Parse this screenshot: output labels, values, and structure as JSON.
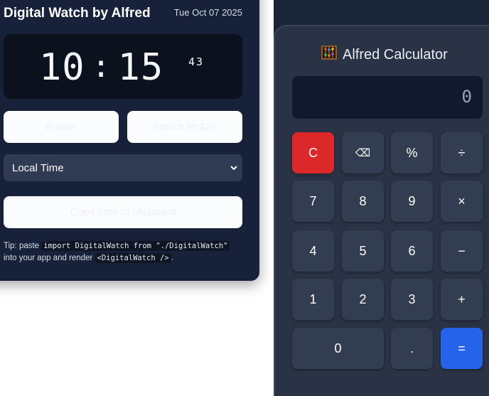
{
  "watch": {
    "title": "Digital Watch by Alfred",
    "date": "Tue Oct 07 2025",
    "time": {
      "hours": "10",
      "separator": ":",
      "minutes": "15",
      "seconds": "43"
    },
    "pause_label": "Pause",
    "switch_label": "Switch to 12h",
    "timezone_selected": "Local Time",
    "copy_label": "Copy time to clipboard",
    "tip": {
      "prefix": "Tip: paste",
      "code1": "import DigitalWatch from \"./DigitalWatch\"",
      "middle": "into your app and render",
      "code2": "<DigitalWatch />",
      "suffix": "."
    }
  },
  "calculator": {
    "icon": "abacus-icon",
    "title": "Alfred Calculator",
    "display": "0",
    "keys": {
      "clear": "C",
      "backspace": "⌫",
      "percent": "%",
      "divide": "÷",
      "seven": "7",
      "eight": "8",
      "nine": "9",
      "multiply": "×",
      "four": "4",
      "five": "5",
      "six": "6",
      "minus": "−",
      "one": "1",
      "two": "2",
      "three": "3",
      "plus": "+",
      "zero": "0",
      "dot": ".",
      "equals": "="
    }
  },
  "colors": {
    "watch_panel": "#17213a",
    "clear_key": "#dc2828",
    "equals_key": "#2563eb"
  }
}
